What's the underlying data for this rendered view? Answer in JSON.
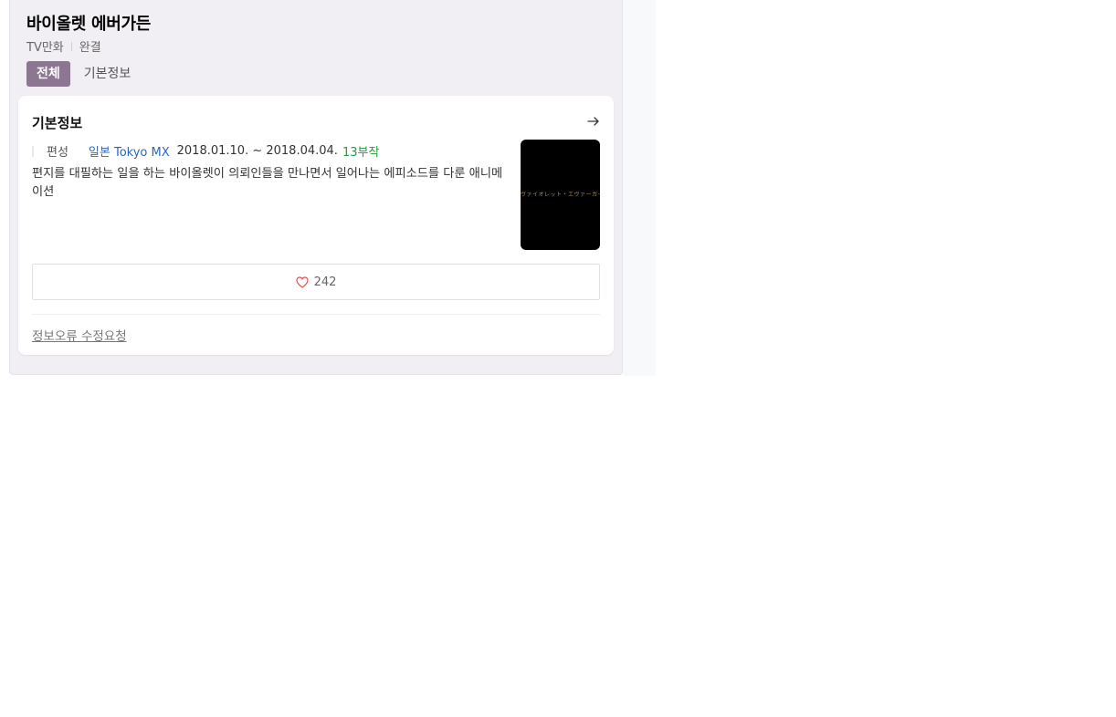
{
  "header": {
    "title": "바이올렛 에버가든",
    "category": "TV만화",
    "status": "완결"
  },
  "tabs": [
    {
      "label": "전체",
      "active": true
    },
    {
      "label": "기본정보",
      "active": false
    }
  ],
  "basic_info": {
    "section_title": "기본정보",
    "arrow_icon": "arrow-right-icon",
    "broadcast_label": "편성",
    "station": "일본 Tokyo MX",
    "dates": "2018.01.10. ~ 2018.04.04.",
    "episodes": "13부작",
    "description": "편지를 대필하는 일을 하는 바이올렛이 의뢰인들을 만나면서 일어나는 에피소드를 다룬 애니메이션",
    "poster_text": "ヴァイオレット・エヴァーガーデン",
    "like_icon": "heart-icon",
    "like_count": "242",
    "report_link": "정보오류 수정요청"
  },
  "colors": {
    "active_tab": "#8c7691",
    "station_link": "#2d66b8",
    "episodes": "#1e9e3b",
    "heart": "#e0505a"
  }
}
